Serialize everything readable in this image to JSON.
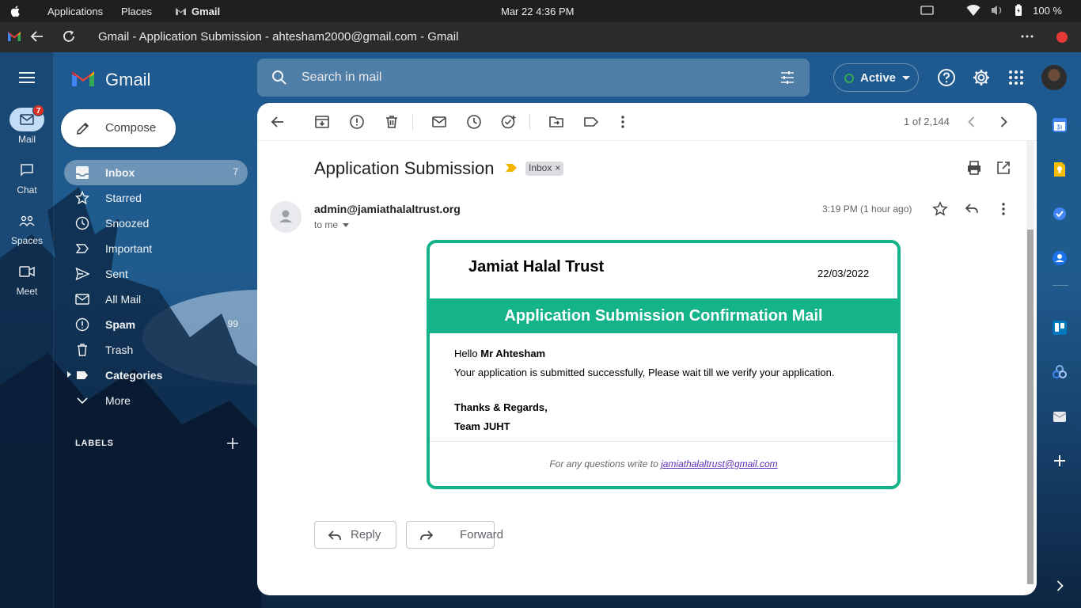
{
  "os_bar": {
    "menu_applications": "Applications",
    "menu_places": "Places",
    "menu_app": "Gmail",
    "datetime": "Mar 22  4:36 PM",
    "battery": "100 %"
  },
  "window": {
    "title": "Gmail - Application Submission - ahtesham2000@gmail.com - Gmail"
  },
  "rail": {
    "mail_label": "Mail",
    "mail_badge": "7",
    "chat_label": "Chat",
    "spaces_label": "Spaces",
    "meet_label": "Meet"
  },
  "brand": {
    "name": "Gmail"
  },
  "compose": {
    "label": "Compose"
  },
  "nav": {
    "items": [
      {
        "label": "Inbox",
        "count": "7"
      },
      {
        "label": "Starred",
        "count": ""
      },
      {
        "label": "Snoozed",
        "count": ""
      },
      {
        "label": "Important",
        "count": ""
      },
      {
        "label": "Sent",
        "count": ""
      },
      {
        "label": "All Mail",
        "count": ""
      },
      {
        "label": "Spam",
        "count": "99"
      },
      {
        "label": "Trash",
        "count": ""
      },
      {
        "label": "Categories",
        "count": ""
      },
      {
        "label": "More",
        "count": ""
      }
    ],
    "labels_header": "LABELS"
  },
  "search": {
    "placeholder": "Search in mail"
  },
  "status": {
    "label": "Active",
    "color": "#34a853"
  },
  "toolbar": {
    "pager": "1 of 2,144"
  },
  "email": {
    "subject": "Application Submission",
    "label_chip": "Inbox",
    "chip_close": "×",
    "sender": "admin@jamiathalaltrust.org",
    "to": "to me",
    "time": "3:19 PM (1 hour ago)",
    "body": {
      "org": "Jamiat Halal Trust",
      "date": "22/03/2022",
      "banner": "Application Submission Confirmation Mail",
      "greeting": "Hello ",
      "name": "Mr Ahtesham",
      "message": "Your application is submitted successfully, Please wait till we verify your application.",
      "thanks": "Thanks & Regards,",
      "team": "Team JUHT",
      "footer_text": "For any questions write to ",
      "footer_email": "jamiathalaltrust@gmail.com",
      "accent_color": "#14b38a"
    },
    "reply_label": "Reply",
    "forward_label": "Forward"
  }
}
